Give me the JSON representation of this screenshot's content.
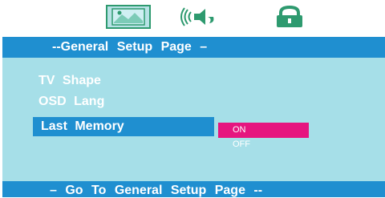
{
  "tabs": [
    {
      "icon": "picture-icon"
    },
    {
      "icon": "audio-icon"
    },
    {
      "icon": "lock-icon"
    }
  ],
  "header": {
    "title": "--General  Setup  Page –"
  },
  "menu": {
    "items": [
      "TV  Shape",
      "OSD  Lang",
      "Last Memory"
    ],
    "selected_index": 2
  },
  "options": {
    "on": "ON",
    "off": "OFF",
    "selected": "ON"
  },
  "footer": {
    "hint": "– Go  To General  Setup  Page --"
  },
  "colors": {
    "header": "#1f8fd0",
    "panel": "#a6dfe8",
    "selected_option": "#e6157f",
    "icons": "#2e9a6f"
  }
}
